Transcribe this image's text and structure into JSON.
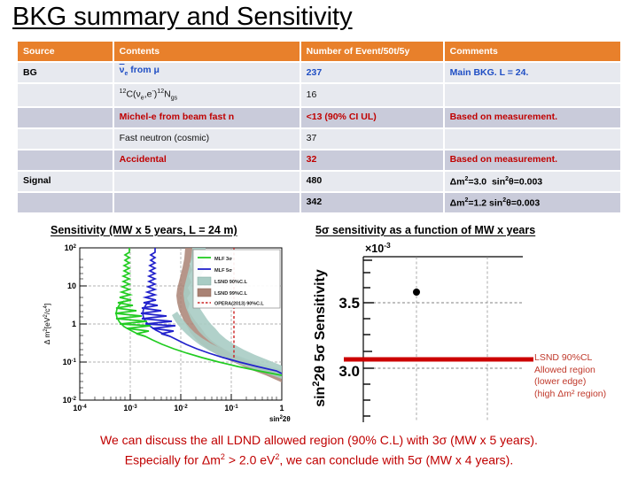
{
  "slide": {
    "title": "BKG summary and Sensitivity"
  },
  "table": {
    "headers": {
      "source": "Source",
      "contents": "Contents",
      "number": "Number of Event/50t/5y",
      "comments": "Comments"
    },
    "rows": [
      {
        "source": "BG",
        "contents": "ν̄e from μ",
        "number": "237",
        "comments": "Main BKG. L = 24.",
        "style": "blue",
        "band": "light"
      },
      {
        "source": "",
        "contents": "12C(νe,e-)12Ngs",
        "number": "16",
        "comments": "",
        "style": "black",
        "band": "light"
      },
      {
        "source": "",
        "contents": "Michel-e from beam fast n",
        "number": "<13 (90% CI UL)",
        "comments": "Based on measurement.",
        "style": "red",
        "band": "dark"
      },
      {
        "source": "",
        "contents": "Fast neutron (cosmic)",
        "number": "37",
        "comments": "",
        "style": "black",
        "band": "light"
      },
      {
        "source": "",
        "contents": "Accidental",
        "number": "32",
        "comments": "Based on measurement.",
        "style": "red",
        "band": "dark"
      },
      {
        "source": "Signal",
        "contents": "",
        "number": "480",
        "comments": "Δm2=3.0  sin2θ=0.003",
        "style": "bold",
        "band": "light"
      },
      {
        "source": "",
        "contents": "",
        "number": "342",
        "comments": "Δm2=1.2 sin2θ=0.003",
        "style": "bold",
        "band": "dark"
      }
    ]
  },
  "charts": [
    {
      "id": "left",
      "title": "Sensitivity (MW x 5 years, L = 24 m)",
      "chart_data": {
        "type": "line",
        "title": "Sensitivity (MW x 5 years, L = 24 m)",
        "xlabel": "sin²2θ",
        "ylabel": "Δ m²[eV²/c⁴]",
        "xscale": "log",
        "yscale": "log",
        "xlim": [
          0.0001,
          1
        ],
        "ylim": [
          0.01,
          100
        ],
        "xticks": [
          "10-4",
          "10-3",
          "10-2",
          "10-1",
          "1"
        ],
        "yticks": [
          "10-2",
          "10-1",
          "1",
          "10",
          "102"
        ],
        "grid": true,
        "legend_position": "upper-right",
        "series": [
          {
            "name": "MLF 3σ",
            "type": "line",
            "color": "#22CC22"
          },
          {
            "name": "MLF 5σ",
            "type": "line",
            "color": "#2222CC"
          },
          {
            "name": "LSND 90%C.L",
            "type": "band",
            "color": "#A8CCC4"
          },
          {
            "name": "LSND 99%C.L",
            "type": "band",
            "color": "#A98274"
          },
          {
            "name": "OPERA(2013) 90%C.L",
            "type": "dashed-vline",
            "color": "#CC2222",
            "x": 0.05
          }
        ]
      }
    },
    {
      "id": "right",
      "title": "5σ sensitivity as a function of MW x years",
      "chart_data": {
        "type": "scatter",
        "title": "5σ sensitivity as a function of MW x years",
        "xlabel": "",
        "ylabel": "sin²2θ 5σ Sensitivity",
        "y_multiplier": "×10-3",
        "yticks": [
          "3.5",
          "3.0"
        ],
        "ylim": [
          2.75,
          3.8
        ],
        "grid": true,
        "points": [
          {
            "x": 1,
            "y": 3.6
          }
        ],
        "reference_line": {
          "value": 3.05,
          "color": "#CC0000",
          "label": "LSND 90%CL lower edge"
        }
      },
      "annotation": {
        "line1": "LSND 90%CL",
        "line2": "Allowed region",
        "line3": "(lower edge)",
        "line4": "(high Δm² region)"
      }
    }
  ],
  "conclusion": {
    "line1": "We can discuss the all LDND allowed region (90% C.L) with 3σ (MW x 5 years).",
    "line2_a": "Especially for Δm",
    "line2_sup1": "2",
    "line2_b": " > 2.0 eV",
    "line2_sup2": "2",
    "line2_c": ", we can conclude with 5σ (MW x 4 years)."
  },
  "colors": {
    "header_orange": "#E8802B",
    "row_light": "#E7E9EF",
    "row_dark": "#C9CBDA",
    "accent_red": "#C00000",
    "accent_blue": "#1F4EC4"
  }
}
